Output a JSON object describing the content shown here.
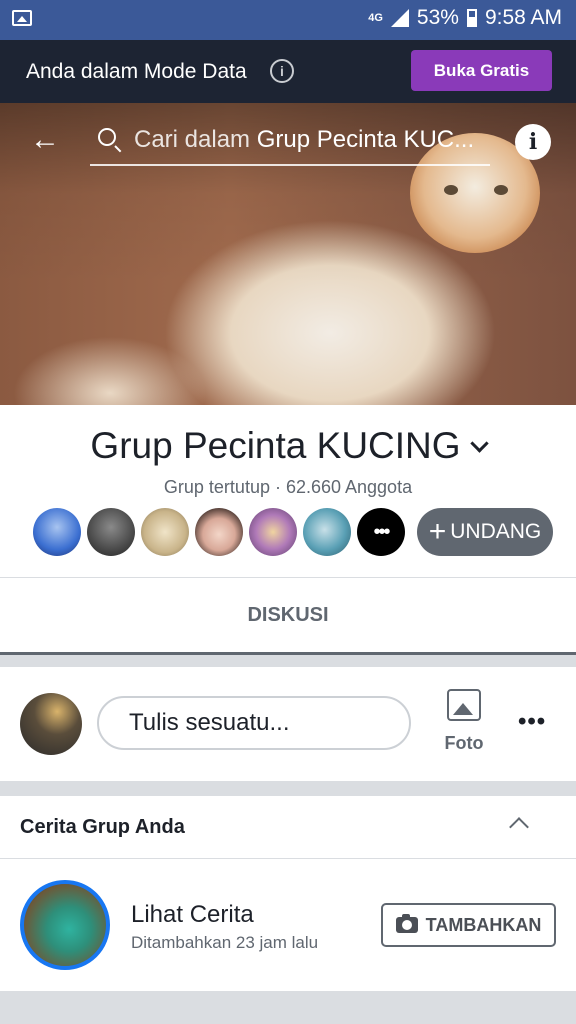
{
  "status_bar": {
    "network": "4G",
    "battery": "53%",
    "time": "9:58 AM"
  },
  "mode_banner": {
    "text": "Anda dalam Mode Data",
    "button": "Buka Gratis"
  },
  "header": {
    "search_prefix": "Cari dalam ",
    "search_group": "Grup Pecinta KUC..."
  },
  "group": {
    "name": "Grup Pecinta KUCING",
    "meta": "Grup tertutup · 62.660 Anggota",
    "invite_label": "UNDANG"
  },
  "tabs": {
    "active": "DISKUSI"
  },
  "composer": {
    "placeholder": "Tulis sesuatu...",
    "photo_label": "Foto"
  },
  "stories": {
    "title": "Cerita Grup Anda",
    "item_title": "Lihat Cerita",
    "item_sub": "Ditambahkan 23 jam lalu",
    "add_label": "TAMBAHKAN"
  },
  "member_avatars": [
    {
      "name": "member-avatar-1",
      "color": "#3b6fd1"
    },
    {
      "name": "member-avatar-2",
      "color": "#4a4a4a"
    },
    {
      "name": "member-avatar-3",
      "color": "#c9b48a"
    },
    {
      "name": "member-avatar-4",
      "color": "#3a2a25"
    },
    {
      "name": "member-avatar-5",
      "color": "#8a5a9a"
    },
    {
      "name": "member-avatar-6",
      "color": "#5aa0b5"
    }
  ],
  "colors": {
    "brand": "#3b5998",
    "mode_bar": "#1d2433",
    "buka_button": "#8a3ab9",
    "story_ring": "#1877f2"
  }
}
